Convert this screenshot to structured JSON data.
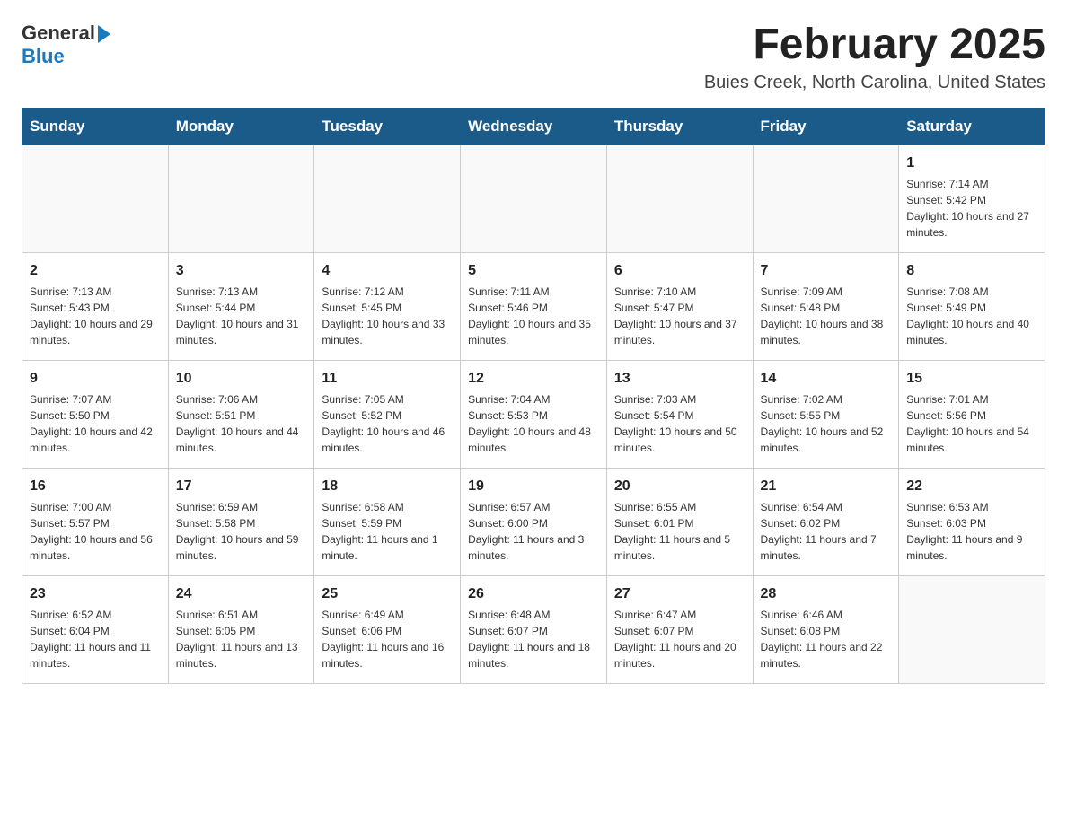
{
  "header": {
    "logo_general": "General",
    "logo_blue": "Blue",
    "month_title": "February 2025",
    "location": "Buies Creek, North Carolina, United States"
  },
  "days_of_week": [
    "Sunday",
    "Monday",
    "Tuesday",
    "Wednesday",
    "Thursday",
    "Friday",
    "Saturday"
  ],
  "weeks": [
    [
      {
        "day": "",
        "info": ""
      },
      {
        "day": "",
        "info": ""
      },
      {
        "day": "",
        "info": ""
      },
      {
        "day": "",
        "info": ""
      },
      {
        "day": "",
        "info": ""
      },
      {
        "day": "",
        "info": ""
      },
      {
        "day": "1",
        "info": "Sunrise: 7:14 AM\nSunset: 5:42 PM\nDaylight: 10 hours and 27 minutes."
      }
    ],
    [
      {
        "day": "2",
        "info": "Sunrise: 7:13 AM\nSunset: 5:43 PM\nDaylight: 10 hours and 29 minutes."
      },
      {
        "day": "3",
        "info": "Sunrise: 7:13 AM\nSunset: 5:44 PM\nDaylight: 10 hours and 31 minutes."
      },
      {
        "day": "4",
        "info": "Sunrise: 7:12 AM\nSunset: 5:45 PM\nDaylight: 10 hours and 33 minutes."
      },
      {
        "day": "5",
        "info": "Sunrise: 7:11 AM\nSunset: 5:46 PM\nDaylight: 10 hours and 35 minutes."
      },
      {
        "day": "6",
        "info": "Sunrise: 7:10 AM\nSunset: 5:47 PM\nDaylight: 10 hours and 37 minutes."
      },
      {
        "day": "7",
        "info": "Sunrise: 7:09 AM\nSunset: 5:48 PM\nDaylight: 10 hours and 38 minutes."
      },
      {
        "day": "8",
        "info": "Sunrise: 7:08 AM\nSunset: 5:49 PM\nDaylight: 10 hours and 40 minutes."
      }
    ],
    [
      {
        "day": "9",
        "info": "Sunrise: 7:07 AM\nSunset: 5:50 PM\nDaylight: 10 hours and 42 minutes."
      },
      {
        "day": "10",
        "info": "Sunrise: 7:06 AM\nSunset: 5:51 PM\nDaylight: 10 hours and 44 minutes."
      },
      {
        "day": "11",
        "info": "Sunrise: 7:05 AM\nSunset: 5:52 PM\nDaylight: 10 hours and 46 minutes."
      },
      {
        "day": "12",
        "info": "Sunrise: 7:04 AM\nSunset: 5:53 PM\nDaylight: 10 hours and 48 minutes."
      },
      {
        "day": "13",
        "info": "Sunrise: 7:03 AM\nSunset: 5:54 PM\nDaylight: 10 hours and 50 minutes."
      },
      {
        "day": "14",
        "info": "Sunrise: 7:02 AM\nSunset: 5:55 PM\nDaylight: 10 hours and 52 minutes."
      },
      {
        "day": "15",
        "info": "Sunrise: 7:01 AM\nSunset: 5:56 PM\nDaylight: 10 hours and 54 minutes."
      }
    ],
    [
      {
        "day": "16",
        "info": "Sunrise: 7:00 AM\nSunset: 5:57 PM\nDaylight: 10 hours and 56 minutes."
      },
      {
        "day": "17",
        "info": "Sunrise: 6:59 AM\nSunset: 5:58 PM\nDaylight: 10 hours and 59 minutes."
      },
      {
        "day": "18",
        "info": "Sunrise: 6:58 AM\nSunset: 5:59 PM\nDaylight: 11 hours and 1 minute."
      },
      {
        "day": "19",
        "info": "Sunrise: 6:57 AM\nSunset: 6:00 PM\nDaylight: 11 hours and 3 minutes."
      },
      {
        "day": "20",
        "info": "Sunrise: 6:55 AM\nSunset: 6:01 PM\nDaylight: 11 hours and 5 minutes."
      },
      {
        "day": "21",
        "info": "Sunrise: 6:54 AM\nSunset: 6:02 PM\nDaylight: 11 hours and 7 minutes."
      },
      {
        "day": "22",
        "info": "Sunrise: 6:53 AM\nSunset: 6:03 PM\nDaylight: 11 hours and 9 minutes."
      }
    ],
    [
      {
        "day": "23",
        "info": "Sunrise: 6:52 AM\nSunset: 6:04 PM\nDaylight: 11 hours and 11 minutes."
      },
      {
        "day": "24",
        "info": "Sunrise: 6:51 AM\nSunset: 6:05 PM\nDaylight: 11 hours and 13 minutes."
      },
      {
        "day": "25",
        "info": "Sunrise: 6:49 AM\nSunset: 6:06 PM\nDaylight: 11 hours and 16 minutes."
      },
      {
        "day": "26",
        "info": "Sunrise: 6:48 AM\nSunset: 6:07 PM\nDaylight: 11 hours and 18 minutes."
      },
      {
        "day": "27",
        "info": "Sunrise: 6:47 AM\nSunset: 6:07 PM\nDaylight: 11 hours and 20 minutes."
      },
      {
        "day": "28",
        "info": "Sunrise: 6:46 AM\nSunset: 6:08 PM\nDaylight: 11 hours and 22 minutes."
      },
      {
        "day": "",
        "info": ""
      }
    ]
  ]
}
